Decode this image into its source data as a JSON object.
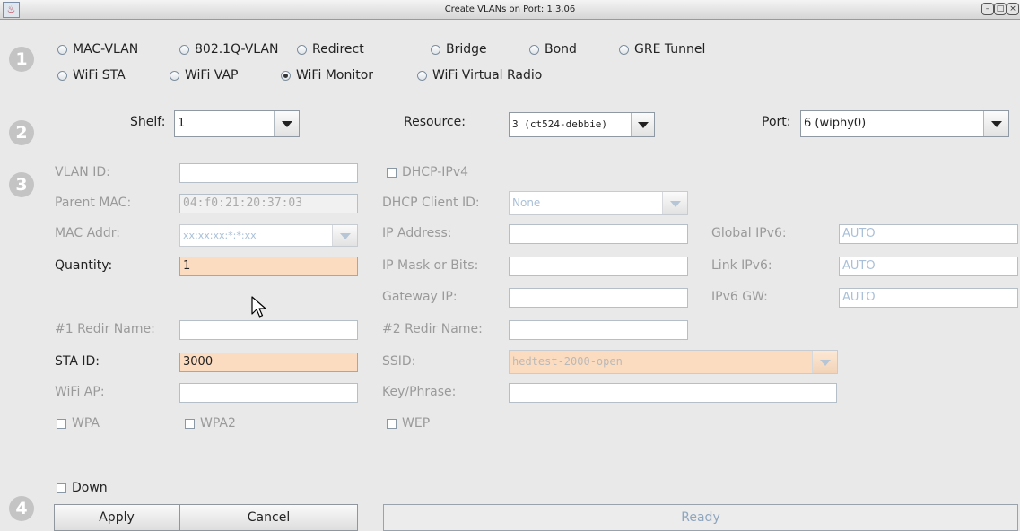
{
  "window": {
    "title": "Create VLANs on Port: 1.3.06"
  },
  "steps": [
    "1",
    "2",
    "3",
    "4"
  ],
  "type_options": {
    "mac_vlan": "MAC-VLAN",
    "dot1q_vlan": "802.1Q-VLAN",
    "redirect": "Redirect",
    "bridge": "Bridge",
    "bond": "Bond",
    "gre_tunnel": "GRE Tunnel",
    "wifi_sta": "WiFi STA",
    "wifi_vap": "WiFi VAP",
    "wifi_monitor": "WiFi Monitor",
    "wifi_virtual_radio": "WiFi Virtual Radio",
    "selected": "WiFi Monitor"
  },
  "location": {
    "shelf_label": "Shelf:",
    "shelf_value": "1",
    "resource_label": "Resource:",
    "resource_value": "3 (ct524-debbie)",
    "port_label": "Port:",
    "port_value": "6 (wiphy0)"
  },
  "form": {
    "vlan_id_label": "VLAN ID:",
    "vlan_id_value": "",
    "parent_mac_label": "Parent MAC:",
    "parent_mac_value": "04:f0:21:20:37:03",
    "mac_addr_label": "MAC Addr:",
    "mac_addr_value": "xx:xx:xx:*:*:xx",
    "quantity_label": "Quantity:",
    "quantity_value": "1",
    "redir1_label": "#1 Redir Name:",
    "redir1_value": "",
    "sta_id_label": "STA ID:",
    "sta_id_value": "3000",
    "wifi_ap_label": "WiFi AP:",
    "wifi_ap_value": "",
    "wpa_label": "WPA",
    "wpa2_label": "WPA2",
    "dhcp_ipv4_label": "DHCP-IPv4",
    "dhcp_client_id_label": "DHCP Client ID:",
    "dhcp_client_id_value": "None",
    "ip_address_label": "IP Address:",
    "ip_address_value": "",
    "ip_mask_label": "IP Mask or Bits:",
    "ip_mask_value": "",
    "gateway_ip_label": "Gateway IP:",
    "gateway_ip_value": "",
    "redir2_label": "#2 Redir Name:",
    "redir2_value": "",
    "ssid_label": "SSID:",
    "ssid_value": "hedtest-2000-open",
    "key_phrase_label": "Key/Phrase:",
    "key_phrase_value": "",
    "wep_label": "WEP",
    "global_ipv6_label": "Global IPv6:",
    "global_ipv6_value": "AUTO",
    "link_ipv6_label": "Link IPv6:",
    "link_ipv6_value": "AUTO",
    "ipv6_gw_label": "IPv6 GW:",
    "ipv6_gw_value": "AUTO"
  },
  "footer": {
    "down_label": "Down",
    "apply_label": "Apply",
    "cancel_label": "Cancel",
    "status_text": "Ready"
  },
  "colors": {
    "required_field": "#fcdcc0",
    "disabled_text": "#9a9a9a",
    "step_badge": "#c4c4c4"
  }
}
